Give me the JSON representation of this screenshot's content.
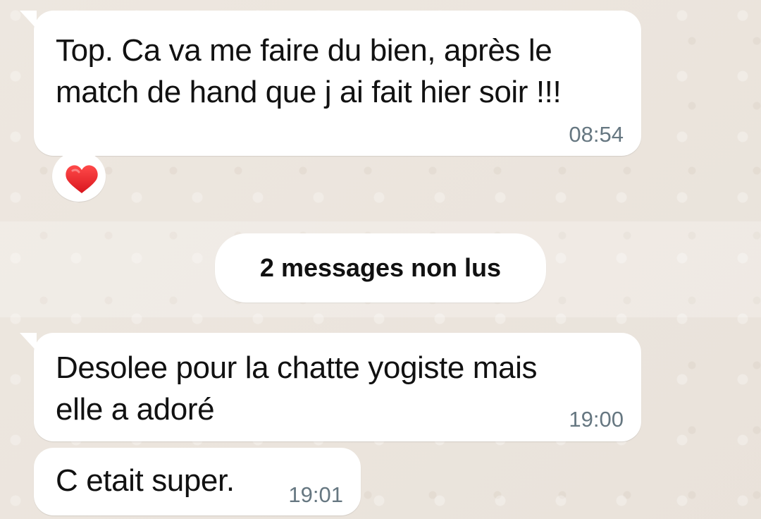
{
  "colors": {
    "chat_background": "#ece5dd",
    "bubble_background": "#ffffff",
    "text": "#111111",
    "timestamp": "#667781",
    "heart": "#e8262d"
  },
  "messages": [
    {
      "text": "Top. Ca va me faire du bien, après le\nmatch de hand que j ai fait hier soir !!!",
      "time": "08:54",
      "reaction": {
        "emoji_name": "heart-icon"
      }
    },
    {
      "text": "Desolee pour la chatte yogiste mais\nelle a adoré",
      "time": "19:00"
    },
    {
      "text": "C etait super.",
      "time": "19:01"
    }
  ],
  "unread_separator": {
    "label": "2 messages non lus"
  }
}
